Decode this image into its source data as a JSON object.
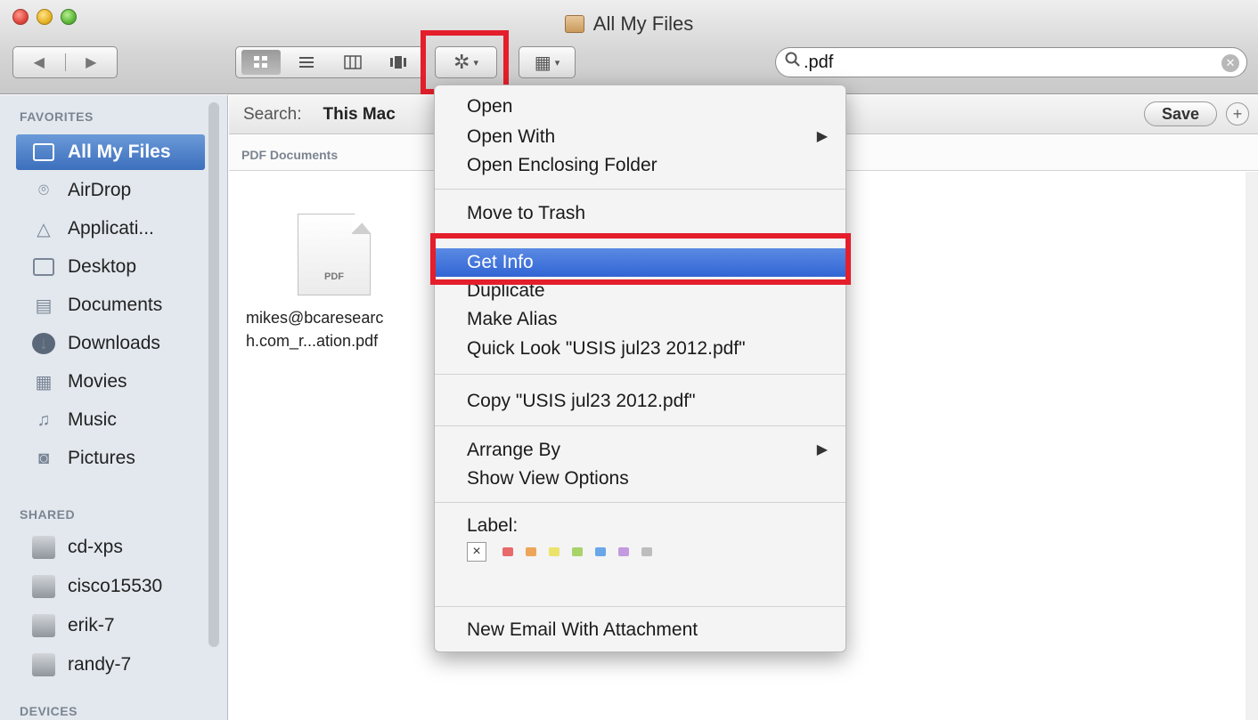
{
  "window": {
    "title": "All My Files"
  },
  "toolbar": {
    "back": "◀",
    "forward": "▶",
    "view_modes": [
      "icon",
      "list",
      "column",
      "cover-flow"
    ],
    "action_glyph": "✲",
    "arrange_glyph": "▦",
    "caret": "▾"
  },
  "search": {
    "value": ".pdf",
    "placeholder": ""
  },
  "sidebar": {
    "favorites_header": "FAVORITES",
    "favorites": [
      {
        "label": "All My Files",
        "icon": "all-files-icon"
      },
      {
        "label": "AirDrop",
        "icon": "airdrop-icon"
      },
      {
        "label": "Applicati...",
        "icon": "applications-icon"
      },
      {
        "label": "Desktop",
        "icon": "desktop-icon"
      },
      {
        "label": "Documents",
        "icon": "documents-icon"
      },
      {
        "label": "Downloads",
        "icon": "downloads-icon"
      },
      {
        "label": "Movies",
        "icon": "movies-icon"
      },
      {
        "label": "Music",
        "icon": "music-icon"
      },
      {
        "label": "Pictures",
        "icon": "pictures-icon"
      }
    ],
    "shared_header": "SHARED",
    "shared": [
      {
        "label": "cd-xps"
      },
      {
        "label": "cisco15530"
      },
      {
        "label": "erik-7"
      },
      {
        "label": "randy-7"
      }
    ],
    "devices_header": "DEVICES"
  },
  "searchbar": {
    "label": "Search:",
    "scope": "This Mac",
    "save": "Save",
    "add": "+"
  },
  "group": {
    "title": "PDF Documents"
  },
  "file": {
    "badge": "PDF",
    "name_line1": "mikes@bcaresearc",
    "name_line2": "h.com_r...ation.pdf"
  },
  "menu": {
    "items": [
      {
        "label": "Open",
        "submenu": false
      },
      {
        "label": "Open With",
        "submenu": true
      },
      {
        "label": "Open Enclosing Folder",
        "submenu": false
      },
      {
        "label": "Move to Trash",
        "submenu": false
      },
      {
        "label": "Get Info",
        "submenu": false,
        "highlighted": true
      },
      {
        "label": "Duplicate",
        "submenu": false
      },
      {
        "label": "Make Alias",
        "submenu": false
      },
      {
        "label": "Quick Look \"USIS jul23 2012.pdf\"",
        "submenu": false
      },
      {
        "label": "Copy \"USIS jul23 2012.pdf\"",
        "submenu": false
      },
      {
        "label": "Arrange By",
        "submenu": true
      },
      {
        "label": "Show View Options",
        "submenu": false
      },
      {
        "label": "Label:",
        "submenu": false
      },
      {
        "label": "New Email With Attachment",
        "submenu": false
      }
    ],
    "label_clear": "×",
    "label_colors": [
      "#e86a6a",
      "#eda55a",
      "#ece36b",
      "#a8d36a",
      "#6aa6e8",
      "#c39ae0",
      "#bdbdbd"
    ],
    "submenu_arrow": "▶"
  },
  "colors": {
    "highlight": "#3165d4",
    "annotation": "#e41e2b",
    "sidebar_bg": "#e3e8ee"
  }
}
